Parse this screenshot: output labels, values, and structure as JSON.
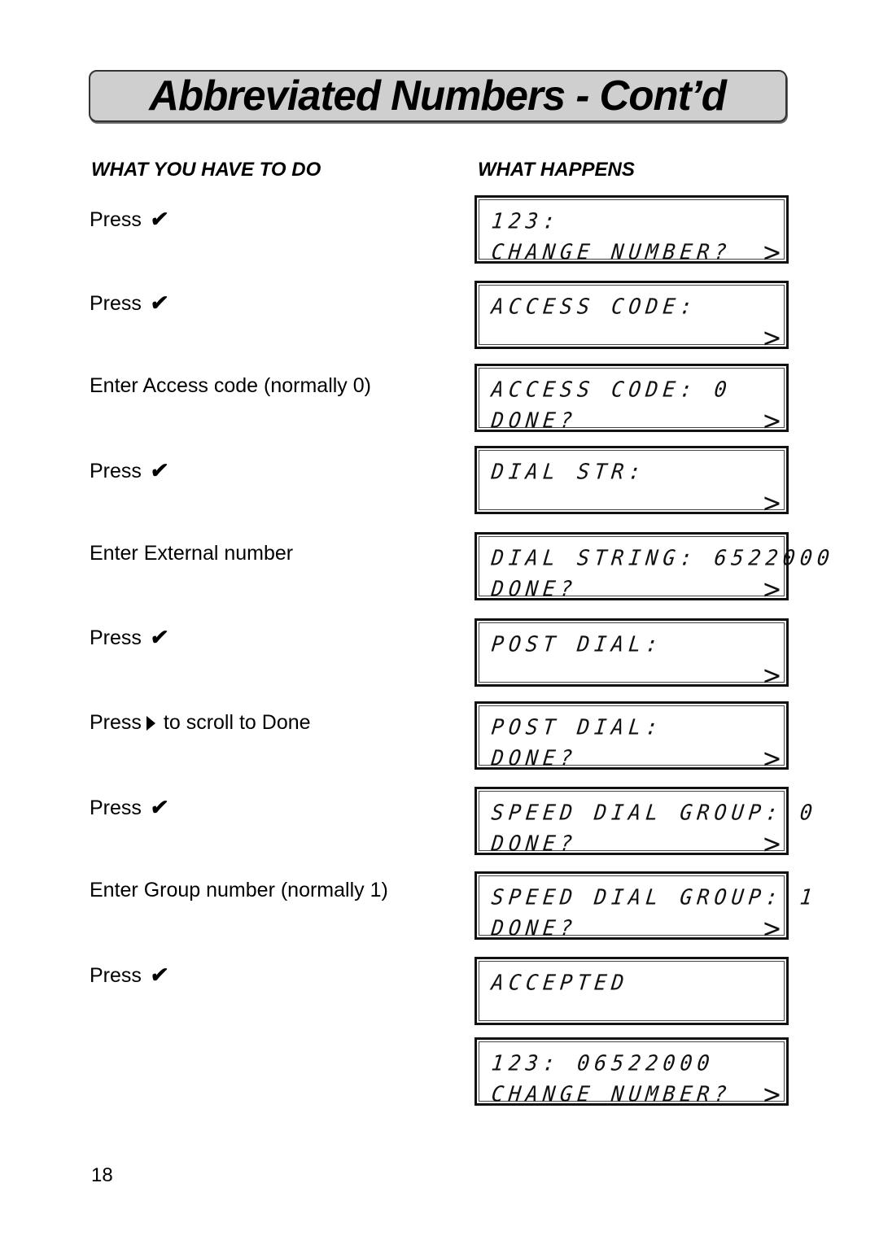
{
  "page": {
    "title": "Abbreviated Numbers - Cont’d",
    "page_number": "18"
  },
  "columns": {
    "left_header": "WHAT YOU HAVE TO DO",
    "right_header": "WHAT HAPPENS"
  },
  "icons": {
    "check": "✔",
    "arrow": ">"
  },
  "steps": [
    {
      "text": "Press",
      "icon": "check-icon",
      "after": ""
    },
    {
      "text": "Press",
      "icon": "check-icon",
      "after": ""
    },
    {
      "text": "Enter Access code (normally 0)",
      "icon": "",
      "after": ""
    },
    {
      "text": "Press",
      "icon": "check-icon",
      "after": ""
    },
    {
      "text": "Enter External number",
      "icon": "",
      "after": ""
    },
    {
      "text": "Press",
      "icon": "check-icon",
      "after": ""
    },
    {
      "text": "Press",
      "icon": "right-triangle-icon",
      "after": "to scroll to Done"
    },
    {
      "text": "Press",
      "icon": "check-icon",
      "after": ""
    },
    {
      "text": "Enter Group number (normally 1)",
      "icon": "",
      "after": ""
    },
    {
      "text": "Press",
      "icon": "check-icon",
      "after": ""
    }
  ],
  "displays": [
    {
      "line1": "123:",
      "line2": "CHANGE NUMBER?",
      "arrow": true
    },
    {
      "line1": "ACCESS CODE:",
      "line2": "",
      "arrow": true
    },
    {
      "line1": "ACCESS CODE: 0",
      "line2": "DONE?",
      "arrow": true
    },
    {
      "line1": "DIAL STR:",
      "line2": "",
      "arrow": true
    },
    {
      "line1": "DIAL STRING: 6522000",
      "line2": "DONE?",
      "arrow": true
    },
    {
      "line1": "POST DIAL:",
      "line2": "",
      "arrow": true
    },
    {
      "line1": "POST DIAL:",
      "line2": "DONE?",
      "arrow": true
    },
    {
      "line1": "SPEED DIAL GROUP: 0",
      "line2": "DONE?",
      "arrow": true
    },
    {
      "line1": "SPEED DIAL GROUP: 1",
      "line2": "DONE?",
      "arrow": true
    },
    {
      "line1": "ACCEPTED",
      "line2": "",
      "arrow": false
    },
    {
      "line1": "123: 06522000",
      "line2": "CHANGE NUMBER?",
      "arrow": true
    }
  ]
}
